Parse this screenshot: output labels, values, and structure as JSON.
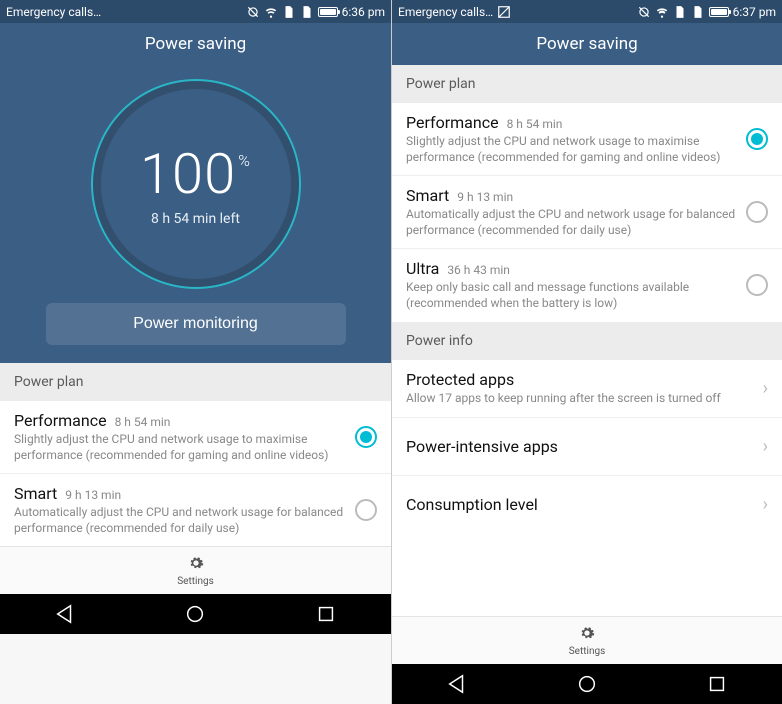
{
  "left": {
    "statusbar": {
      "carrier": "Emergency calls…",
      "time": "6:36 pm"
    },
    "title": "Power saving",
    "battery_pct": "100",
    "pct_sym": "%",
    "time_left": "8 h 54 min left",
    "monitor_btn": "Power monitoring",
    "sections": {
      "power_plan": "Power plan"
    },
    "plans": [
      {
        "name": "Performance",
        "time": "8 h 54 min",
        "desc": "Slightly adjust the CPU and network usage to maximise performance (recommended for gaming and online videos)",
        "selected": true
      },
      {
        "name": "Smart",
        "time": "9 h 13 min",
        "desc": "Automatically adjust the CPU and network usage for balanced performance (recommended for daily use)",
        "selected": false
      }
    ],
    "settings_label": "Settings"
  },
  "right": {
    "statusbar": {
      "carrier": "Emergency calls…",
      "time": "6:37 pm"
    },
    "title": "Power saving",
    "sections": {
      "power_plan": "Power plan",
      "power_info": "Power info"
    },
    "plans": [
      {
        "name": "Performance",
        "time": "8 h 54 min",
        "desc": "Slightly adjust the CPU and network usage to maximise performance (recommended for gaming and online videos)",
        "selected": true
      },
      {
        "name": "Smart",
        "time": "9 h 13 min",
        "desc": "Automatically adjust the CPU and network usage for balanced performance (recommended for daily use)",
        "selected": false
      },
      {
        "name": "Ultra",
        "time": "36 h 43 min",
        "desc": "Keep only basic call and message functions available (recommended when the battery is low)",
        "selected": false
      }
    ],
    "info_items": [
      {
        "name": "Protected apps",
        "desc": "Allow 17 apps to keep running after the screen is turned off"
      },
      {
        "name": "Power-intensive apps",
        "desc": ""
      },
      {
        "name": "Consumption level",
        "desc": ""
      }
    ],
    "settings_label": "Settings"
  }
}
